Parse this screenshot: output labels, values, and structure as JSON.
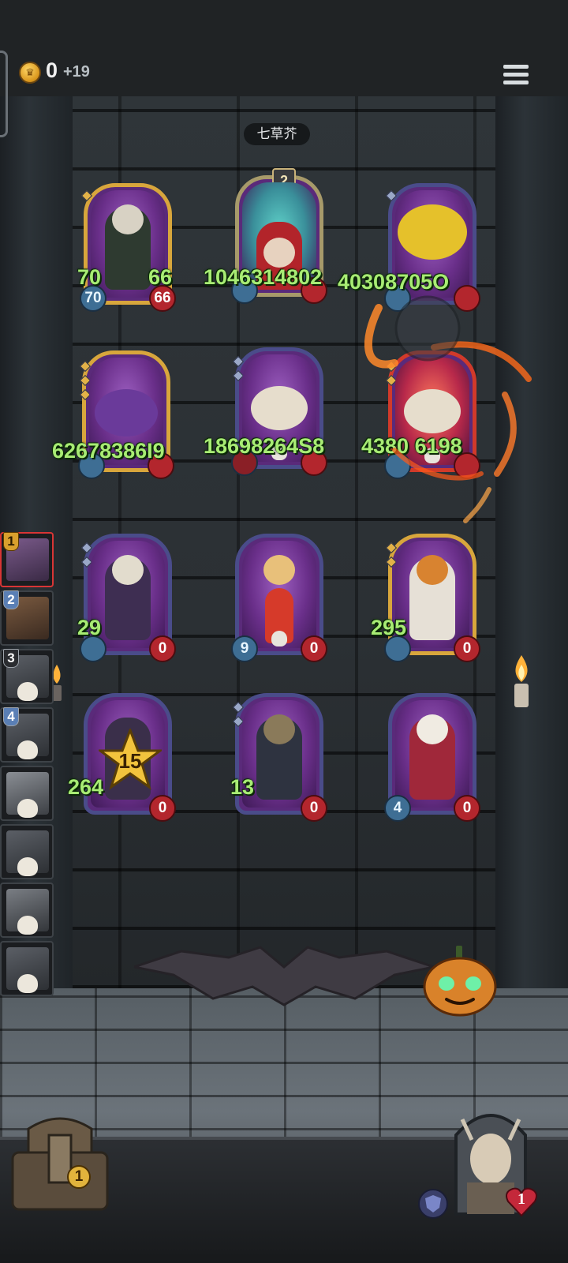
{
  "top_bar": {
    "coin_count": "0",
    "coin_bonus": "+19",
    "coin_icon": "crown-coin-icon",
    "menu_icon": "hamburger-menu-icon"
  },
  "enemy": {
    "name": "七草芥"
  },
  "enemy_cards": [
    {
      "attack": "70",
      "health": "66",
      "overlay": "",
      "frame": "gold"
    },
    {
      "level": "2",
      "attack": "",
      "health": "",
      "overlay": "1046314802",
      "frame": "blue"
    },
    {
      "attack": "",
      "health": "",
      "overlay": "40308705O",
      "frame": "blue"
    },
    {
      "attack": "",
      "health": "",
      "overlay": "62678386I9",
      "frame": "gold"
    },
    {
      "attack": "",
      "health": "",
      "overlay": "18698264S8",
      "frame": "blue"
    },
    {
      "attack": "",
      "health": "",
      "overlay": "4380 6198",
      "frame": "gold"
    }
  ],
  "player_cards": [
    {
      "attack": "29",
      "health": "0",
      "frame": "blue"
    },
    {
      "attack": "9",
      "health": "0",
      "frame": "blue"
    },
    {
      "attack": "295",
      "health": "0",
      "frame": "gold"
    },
    {
      "attack": "264",
      "health": "0",
      "frame": "blue",
      "star": "15"
    },
    {
      "attack": "13",
      "health": "0",
      "frame": "blue"
    },
    {
      "attack": "4",
      "health": "0",
      "frame": "blue"
    }
  ],
  "hand": [
    {
      "slot": "1"
    },
    {
      "slot": "2"
    },
    {
      "slot": "3"
    },
    {
      "slot": "4"
    },
    {
      "slot": ""
    },
    {
      "slot": ""
    },
    {
      "slot": ""
    },
    {
      "slot": ""
    }
  ],
  "bottom": {
    "chest_count": "1",
    "heart_count": "1",
    "shield_icon": "shield-icon",
    "heart_icon": "heart-icon"
  },
  "colors": {
    "gold_frame": "#d8a63c",
    "blue_frame": "#4a4c8a",
    "attack_badge": "#3e6e94",
    "health_badge": "#b3262d",
    "damage_text": "#a8ec74"
  }
}
